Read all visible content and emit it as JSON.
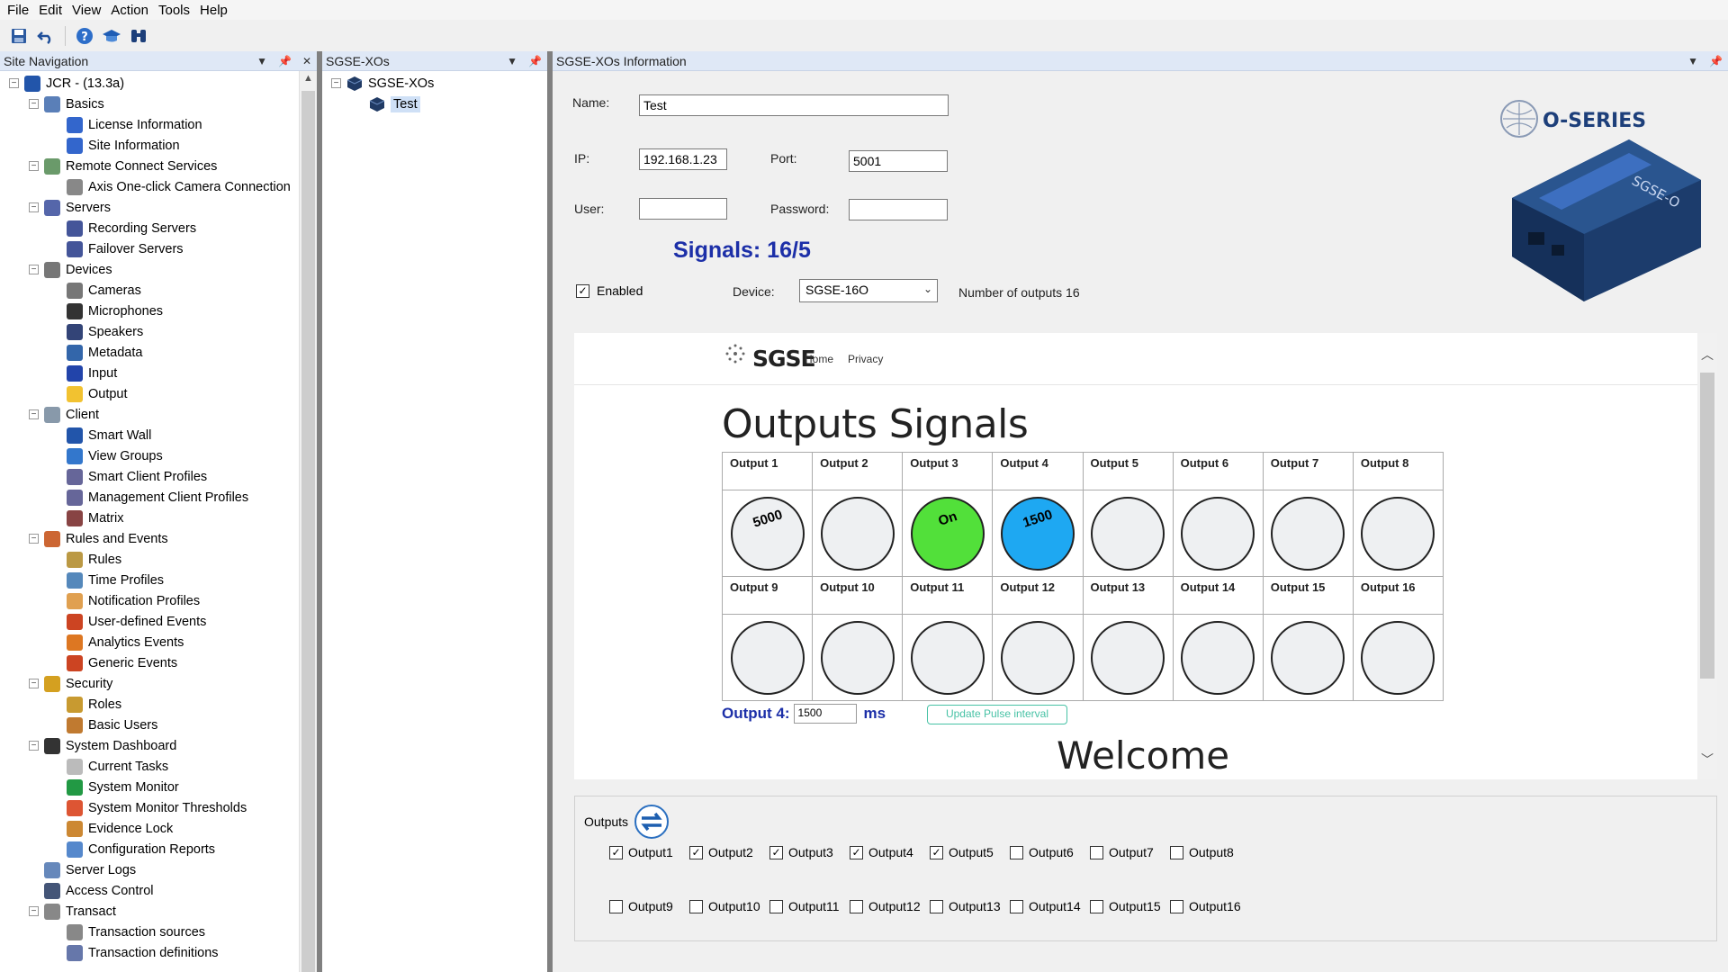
{
  "menu": [
    "File",
    "Edit",
    "View",
    "Action",
    "Tools",
    "Help"
  ],
  "nav": {
    "title": "Site Navigation",
    "tree": [
      {
        "label": "JCR - (13.3a)",
        "level": 0,
        "expander": "−",
        "color": "#2255aa"
      },
      {
        "label": "Basics",
        "level": 1,
        "expander": "−",
        "color": "#5a7fb8"
      },
      {
        "label": "License Information",
        "level": 2,
        "color": "#3366cc"
      },
      {
        "label": "Site Information",
        "level": 2,
        "color": "#3366cc"
      },
      {
        "label": "Remote Connect Services",
        "level": 1,
        "expander": "−",
        "color": "#6a9a6a"
      },
      {
        "label": "Axis One-click Camera Connection",
        "level": 2,
        "color": "#888888"
      },
      {
        "label": "Servers",
        "level": 1,
        "expander": "−",
        "color": "#5566aa"
      },
      {
        "label": "Recording Servers",
        "level": 2,
        "color": "#445599"
      },
      {
        "label": "Failover Servers",
        "level": 2,
        "color": "#445599"
      },
      {
        "label": "Devices",
        "level": 1,
        "expander": "−",
        "color": "#777777"
      },
      {
        "label": "Cameras",
        "level": 2,
        "color": "#777777"
      },
      {
        "label": "Microphones",
        "level": 2,
        "color": "#333333"
      },
      {
        "label": "Speakers",
        "level": 2,
        "color": "#334477"
      },
      {
        "label": "Metadata",
        "level": 2,
        "color": "#3366aa"
      },
      {
        "label": "Input",
        "level": 2,
        "color": "#2244aa"
      },
      {
        "label": "Output",
        "level": 2,
        "color": "#f2c230"
      },
      {
        "label": "Client",
        "level": 1,
        "expander": "−",
        "color": "#8899aa"
      },
      {
        "label": "Smart Wall",
        "level": 2,
        "color": "#2255aa"
      },
      {
        "label": "View Groups",
        "level": 2,
        "color": "#3377cc"
      },
      {
        "label": "Smart Client Profiles",
        "level": 2,
        "color": "#666699"
      },
      {
        "label": "Management Client Profiles",
        "level": 2,
        "color": "#666699"
      },
      {
        "label": "Matrix",
        "level": 2,
        "color": "#884444"
      },
      {
        "label": "Rules and Events",
        "level": 1,
        "expander": "−",
        "color": "#cc6633"
      },
      {
        "label": "Rules",
        "level": 2,
        "color": "#bb9944"
      },
      {
        "label": "Time Profiles",
        "level": 2,
        "color": "#5588bb"
      },
      {
        "label": "Notification Profiles",
        "level": 2,
        "color": "#e0a050"
      },
      {
        "label": "User-defined Events",
        "level": 2,
        "color": "#cc4422"
      },
      {
        "label": "Analytics Events",
        "level": 2,
        "color": "#dd7722"
      },
      {
        "label": "Generic Events",
        "level": 2,
        "color": "#cc4422"
      },
      {
        "label": "Security",
        "level": 1,
        "expander": "−",
        "color": "#d4a020"
      },
      {
        "label": "Roles",
        "level": 2,
        "color": "#c89a30"
      },
      {
        "label": "Basic Users",
        "level": 2,
        "color": "#c07a30"
      },
      {
        "label": "System Dashboard",
        "level": 1,
        "expander": "−",
        "color": "#333333"
      },
      {
        "label": "Current Tasks",
        "level": 2,
        "color": "#bbbbbb"
      },
      {
        "label": "System Monitor",
        "level": 2,
        "color": "#229944"
      },
      {
        "label": "System Monitor Thresholds",
        "level": 2,
        "color": "#dd5533"
      },
      {
        "label": "Evidence Lock",
        "level": 2,
        "color": "#cc8833"
      },
      {
        "label": "Configuration Reports",
        "level": 2,
        "color": "#5588cc"
      },
      {
        "label": "Server Logs",
        "level": 1,
        "color": "#6688bb"
      },
      {
        "label": "Access Control",
        "level": 1,
        "color": "#445577"
      },
      {
        "label": "Transact",
        "level": 1,
        "expander": "−",
        "color": "#888888"
      },
      {
        "label": "Transaction sources",
        "level": 2,
        "color": "#888888"
      },
      {
        "label": "Transaction definitions",
        "level": 2,
        "color": "#6677aa"
      }
    ]
  },
  "xo": {
    "title": "SGSE-XOs",
    "root": "SGSE-XOs",
    "child": "Test"
  },
  "info": {
    "title": "SGSE-XOs Information",
    "name_label": "Name:",
    "name_value": "Test",
    "ip_label": "IP:",
    "ip_value": "192.168.1.23",
    "port_label": "Port:",
    "port_value": "5001",
    "user_label": "User:",
    "user_value": "",
    "password_label": "Password:",
    "password_value": "",
    "signals": "Signals: 16/5",
    "enabled_label": "Enabled",
    "enabled": true,
    "device_label": "Device:",
    "device_value": "SGSE-16O",
    "num_outputs": "Number of outputs 16",
    "product_brand": "O-SERIES",
    "product_model": "SGSE-O"
  },
  "web": {
    "logo": "SGSE",
    "nav_home": "Home",
    "nav_privacy": "Privacy",
    "heading": "Outputs Signals",
    "outputs": [
      {
        "name": "Output 1",
        "text": "5000",
        "color": "#eef0f2"
      },
      {
        "name": "Output 2",
        "text": "",
        "color": "#eef0f2"
      },
      {
        "name": "Output 3",
        "text": "On",
        "color": "#52e03a"
      },
      {
        "name": "Output 4",
        "text": "1500",
        "color": "#1ea8f2"
      },
      {
        "name": "Output 5",
        "text": "",
        "color": "#eef0f2"
      },
      {
        "name": "Output 6",
        "text": "",
        "color": "#eef0f2"
      },
      {
        "name": "Output 7",
        "text": "",
        "color": "#eef0f2"
      },
      {
        "name": "Output 8",
        "text": "",
        "color": "#eef0f2"
      },
      {
        "name": "Output 9",
        "text": "",
        "color": "#eef0f2"
      },
      {
        "name": "Output 10",
        "text": "",
        "color": "#eef0f2"
      },
      {
        "name": "Output 11",
        "text": "",
        "color": "#eef0f2"
      },
      {
        "name": "Output 12",
        "text": "",
        "color": "#eef0f2"
      },
      {
        "name": "Output 13",
        "text": "",
        "color": "#eef0f2"
      },
      {
        "name": "Output 14",
        "text": "",
        "color": "#eef0f2"
      },
      {
        "name": "Output 15",
        "text": "",
        "color": "#eef0f2"
      },
      {
        "name": "Output 16",
        "text": "",
        "color": "#eef0f2"
      }
    ],
    "pulse_label": "Output 4:",
    "pulse_value": "1500",
    "pulse_unit": "ms",
    "pulse_button": "Update Pulse interval",
    "welcome": "Welcome"
  },
  "outputs_group": {
    "title": "Outputs",
    "items": [
      {
        "label": "Output1",
        "checked": true
      },
      {
        "label": "Output2",
        "checked": true
      },
      {
        "label": "Output3",
        "checked": true
      },
      {
        "label": "Output4",
        "checked": true
      },
      {
        "label": "Output5",
        "checked": true
      },
      {
        "label": "Output6",
        "checked": false
      },
      {
        "label": "Output7",
        "checked": false
      },
      {
        "label": "Output8",
        "checked": false
      },
      {
        "label": "Output9",
        "checked": false
      },
      {
        "label": "Output10",
        "checked": false
      },
      {
        "label": "Output11",
        "checked": false
      },
      {
        "label": "Output12",
        "checked": false
      },
      {
        "label": "Output13",
        "checked": false
      },
      {
        "label": "Output14",
        "checked": false
      },
      {
        "label": "Output15",
        "checked": false
      },
      {
        "label": "Output16",
        "checked": false
      }
    ]
  }
}
